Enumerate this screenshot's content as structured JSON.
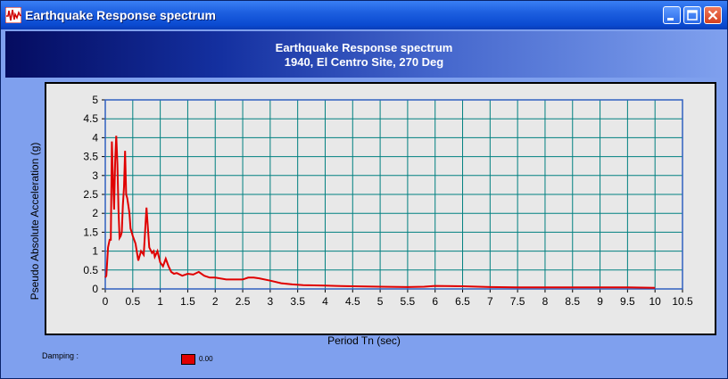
{
  "window": {
    "title": "Earthquake Response spectrum",
    "colors": {
      "titlebar": "#1d5fe0",
      "client": "#7fa0ee",
      "plot_bg": "#e8e8e8",
      "grid": "#008080",
      "series": "#e00000"
    }
  },
  "header": {
    "line1": "Earthquake Response spectrum",
    "line2": "1940, El Centro Site, 270 Deg"
  },
  "legend": {
    "damping_label": "Damping :",
    "series_label": "0.00"
  },
  "chart_data": {
    "type": "line",
    "title": "",
    "xlabel": "Period Tn (sec)",
    "ylabel": "Pseudo Absolute Acceleration (g)",
    "xlim": [
      0,
      10.5
    ],
    "ylim": [
      0,
      5
    ],
    "xticks": [
      "0",
      "0.5",
      "1",
      "1.5",
      "2",
      "2.5",
      "3",
      "3.5",
      "4",
      "4.5",
      "5",
      "5.5",
      "6",
      "6.5",
      "7",
      "7.5",
      "8",
      "8.5",
      "9",
      "9.5",
      "10",
      "10.5"
    ],
    "yticks": [
      "0",
      "0.5",
      "1",
      "1.5",
      "2",
      "2.5",
      "3",
      "3.5",
      "4",
      "4.5",
      "5"
    ],
    "grid": true,
    "legend_position": "bottom-left",
    "series": [
      {
        "name": "0.00",
        "color": "#e00000",
        "x": [
          0.0,
          0.02,
          0.05,
          0.08,
          0.1,
          0.12,
          0.14,
          0.16,
          0.18,
          0.2,
          0.22,
          0.24,
          0.26,
          0.28,
          0.3,
          0.32,
          0.34,
          0.36,
          0.38,
          0.4,
          0.42,
          0.44,
          0.46,
          0.48,
          0.5,
          0.55,
          0.6,
          0.65,
          0.7,
          0.75,
          0.8,
          0.85,
          0.88,
          0.9,
          0.95,
          1.0,
          1.05,
          1.1,
          1.15,
          1.2,
          1.25,
          1.3,
          1.4,
          1.5,
          1.6,
          1.7,
          1.8,
          1.9,
          2.0,
          2.2,
          2.4,
          2.5,
          2.6,
          2.7,
          2.8,
          3.0,
          3.2,
          3.4,
          3.6,
          4.0,
          4.2,
          4.5,
          5.0,
          5.5,
          5.8,
          6.0,
          6.5,
          7.0,
          7.5,
          8.0,
          8.5,
          9.0,
          9.5,
          10.0
        ],
        "y": [
          0.3,
          0.35,
          1.1,
          1.3,
          1.3,
          3.9,
          2.9,
          2.1,
          3.4,
          4.05,
          3.3,
          2.1,
          1.35,
          1.4,
          1.5,
          2.2,
          2.7,
          3.65,
          2.5,
          2.4,
          2.2,
          2.0,
          1.6,
          1.5,
          1.4,
          1.2,
          0.75,
          1.0,
          0.9,
          2.15,
          1.1,
          0.95,
          1.0,
          0.85,
          1.0,
          0.7,
          0.6,
          0.8,
          0.6,
          0.45,
          0.4,
          0.42,
          0.35,
          0.4,
          0.38,
          0.45,
          0.35,
          0.3,
          0.3,
          0.25,
          0.25,
          0.25,
          0.3,
          0.3,
          0.28,
          0.22,
          0.15,
          0.12,
          0.1,
          0.09,
          0.08,
          0.07,
          0.06,
          0.05,
          0.06,
          0.08,
          0.07,
          0.05,
          0.04,
          0.04,
          0.04,
          0.04,
          0.04,
          0.03
        ]
      }
    ]
  }
}
